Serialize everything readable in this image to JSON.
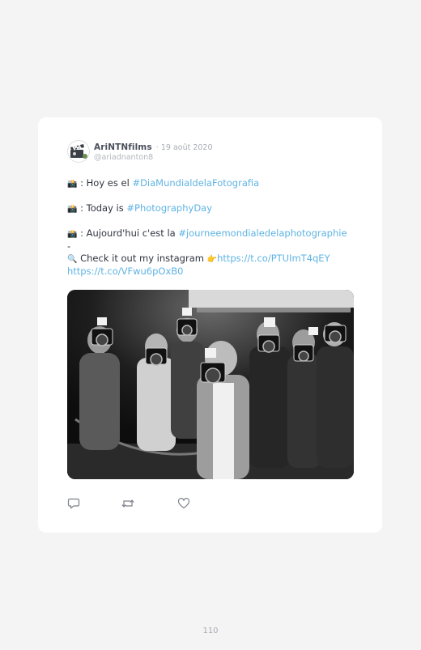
{
  "tweet": {
    "author": "AriNTNfilms",
    "date": "· 19 août 2020",
    "handle": "@ariadnanton8",
    "lines": {
      "l1_prefix": ": Hoy es el ",
      "l1_link": "#DiaMundialdelaFotografia",
      "l2_prefix": ": Today is ",
      "l2_link": "#PhotographyDay",
      "l3_prefix": ": Aujourd'hui c'est la ",
      "l3_link": "#journeemondialedelaphotographie",
      "l4": "-",
      "l5_prefix": "Check it out my instagram ",
      "l5_link": "https://t.co/PTUImT4qEY",
      "l6_link": "https://t.co/VFwu6pOxB0"
    },
    "emoji": {
      "camera": "📸",
      "magnifier": "🔍",
      "pointing_hand": "👉"
    },
    "icons": [
      "reply-icon",
      "retweet-icon",
      "like-icon"
    ],
    "link_color": "#5fb3e3"
  },
  "page_number": "110"
}
